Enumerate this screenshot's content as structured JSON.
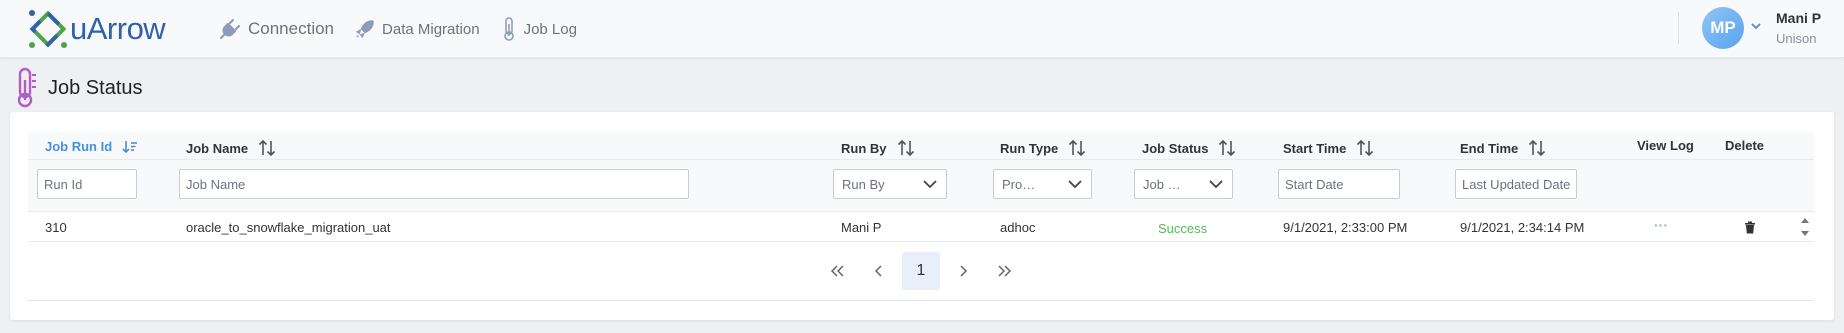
{
  "app": {
    "logo_text": "uArrow"
  },
  "nav": {
    "items": [
      {
        "label": "Connection",
        "icon": "plug-icon"
      },
      {
        "label": "Data Migration",
        "icon": "rocket-icon"
      },
      {
        "label": "Job Log",
        "icon": "thermometer-icon"
      }
    ]
  },
  "user": {
    "initials": "MP",
    "name": "Mani P",
    "org": "Unison"
  },
  "page": {
    "title": "Job Status",
    "icon": "thermometer-icon"
  },
  "table": {
    "columns": [
      {
        "label": "Job Run Id",
        "sort": "active-desc"
      },
      {
        "label": "Job Name",
        "sort": "both"
      },
      {
        "label": "Run By",
        "sort": "both"
      },
      {
        "label": "Run Type",
        "sort": "both"
      },
      {
        "label": "Job Status",
        "sort": "both"
      },
      {
        "label": "Start Time",
        "sort": "both"
      },
      {
        "label": "End Time",
        "sort": "both"
      },
      {
        "label": "View Log",
        "sort": "none"
      },
      {
        "label": "Delete",
        "sort": "none"
      }
    ],
    "filters": {
      "run_id": "Run Id",
      "job_name": "Job Name",
      "run_by": "Run By",
      "run_type": "Pro…",
      "job_status": "Job …",
      "start_date": "Start Date",
      "end_date": "Last Updated Date"
    },
    "rows": [
      {
        "run_id": "310",
        "job_name": "oracle_to_snowflake_migration_uat",
        "run_by": "Mani P",
        "run_type": "adhoc",
        "status": "Success",
        "start_time": "9/1/2021, 2:33:00 PM",
        "end_time": "9/1/2021, 2:34:14 PM",
        "view_log": "···"
      }
    ]
  },
  "pagination": {
    "current_page": "1"
  },
  "colors": {
    "accent": "#4a8fdc",
    "success": "#5cb85c",
    "page_icon": "#b05cc7"
  }
}
